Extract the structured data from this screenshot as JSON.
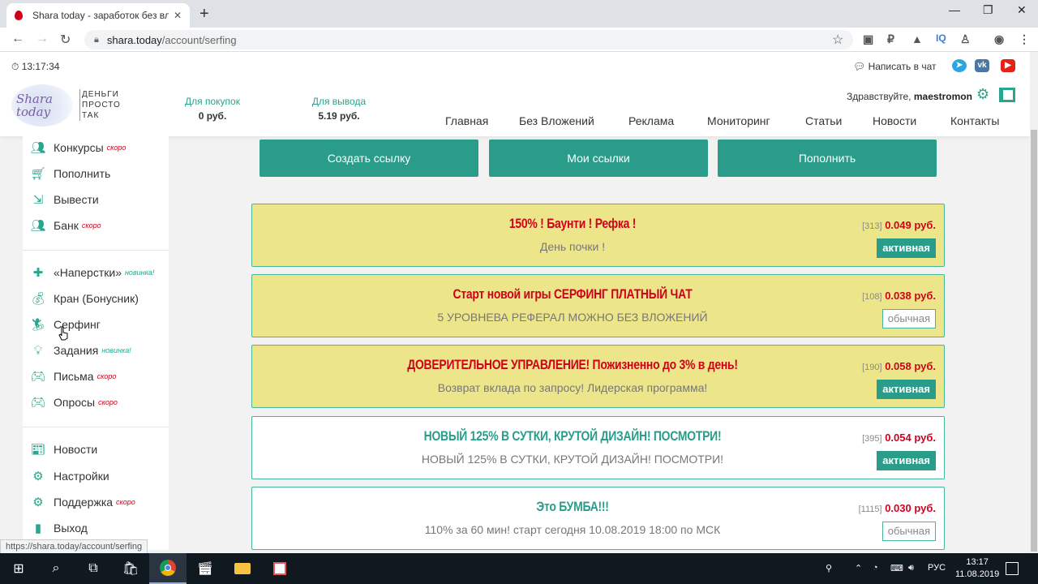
{
  "browser": {
    "tab_title": "Shara today - заработок без вл",
    "url_host": "shara.today",
    "url_path": "/account/serfing",
    "status_url": "https://shara.today/account/serfing"
  },
  "topbar": {
    "time": "13:17:34",
    "chat_label": "Написать в чат"
  },
  "header": {
    "logo_text": "Shara today",
    "logo_words": [
      "ДЕНЬГИ",
      "ПРОСТО",
      "ТАК"
    ],
    "balances": [
      {
        "label": "Для покупок",
        "value": "0 руб."
      },
      {
        "label": "Для вывода",
        "value": "5.19 руб."
      }
    ],
    "greeting": "Здравствуйте,",
    "username": "maestromon",
    "menu": [
      "Главная",
      "Без Вложений",
      "Реклама",
      "Мониторинг",
      "Статьи",
      "Новости",
      "Контакты"
    ]
  },
  "sidebar": {
    "group1": [
      {
        "label": "Конкурсы",
        "tag": "скоро",
        "icon": "users-icon"
      },
      {
        "label": "Пополнить",
        "tag": "",
        "icon": "cart-icon"
      },
      {
        "label": "Вывести",
        "tag": "",
        "icon": "withdraw-icon"
      },
      {
        "label": "Банк",
        "tag": "скоро",
        "icon": "bank-icon"
      }
    ],
    "group2": [
      {
        "label": "«Наперстки»",
        "tag": "новинка!",
        "icon": "puzzle-icon"
      },
      {
        "label": "Кран (Бонусник)",
        "tag": "",
        "icon": "money-bag-icon"
      },
      {
        "label": "Серфинг",
        "tag": "",
        "icon": "surfer-icon"
      },
      {
        "label": "Задания",
        "tag": "новинка!",
        "icon": "bulb-icon"
      },
      {
        "label": "Письма",
        "tag": "скоро",
        "icon": "gamepad-icon"
      },
      {
        "label": "Опросы",
        "tag": "скоро",
        "icon": "gamepad-icon"
      }
    ],
    "group3": [
      {
        "label": "Новости",
        "tag": "",
        "icon": "news-icon"
      },
      {
        "label": "Настройки",
        "tag": "",
        "icon": "gear-icon"
      },
      {
        "label": "Поддержка",
        "tag": "скоро",
        "icon": "support-icon"
      },
      {
        "label": "Выход",
        "tag": "",
        "icon": "exit-icon"
      }
    ]
  },
  "actions": [
    "Создать ссылку",
    "Мои ссылки",
    "Пополнить"
  ],
  "links": [
    {
      "title": "150% ! Баунти ! Рефка !",
      "subtitle": "День почки !",
      "count": "[313]",
      "price": "0.049 руб.",
      "status": "активная",
      "title_color": "#d0021b",
      "bg": "yellow",
      "status_type": "active"
    },
    {
      "title": "Старт новой игры СЕРФИНГ ПЛАТНЫЙ ЧАТ",
      "subtitle": "5 УРОВНЕВА РЕФЕРАЛ МОЖНО БЕЗ ВЛОЖЕНИЙ",
      "count": "[108]",
      "price": "0.038 руб.",
      "status": "обычная",
      "title_color": "#d0021b",
      "bg": "yellow",
      "status_type": "ordinary"
    },
    {
      "title": "ДОВЕРИТЕЛЬНОЕ УПРАВЛЕНИЕ! Пожизненно до 3% в день!",
      "subtitle": "Возврат вклада по запросу! Лидерская программа!",
      "count": "[190]",
      "price": "0.058 руб.",
      "status": "активная",
      "title_color": "#d0021b",
      "bg": "yellow",
      "status_type": "active"
    },
    {
      "title": "НОВЫЙ 125% В СУТКИ, КРУТОЙ ДИЗАЙН! ПОСМОТРИ!",
      "subtitle": "НОВЫЙ 125% В СУТКИ, КРУТОЙ ДИЗАЙН! ПОСМОТРИ!",
      "count": "[395]",
      "price": "0.054 руб.",
      "status": "активная",
      "title_color": "#2a9d8a",
      "bg": "white",
      "status_type": "active"
    },
    {
      "title": "Это БУМБА!!!",
      "subtitle": "110% за 60 мин! старт сегодня 10.08.2019 18:00 по МСК",
      "count": "[1115]",
      "price": "0.030 руб.",
      "status": "обычная",
      "title_color": "#2a9d8a",
      "bg": "white",
      "status_type": "ordinary"
    }
  ],
  "taskbar": {
    "lang": "РУС",
    "time": "13:17",
    "date": "11.08.2019"
  },
  "colors": {
    "accent": "#2a9d8a",
    "price_red": "#d0021b",
    "card_yellow": "#ece58a"
  }
}
